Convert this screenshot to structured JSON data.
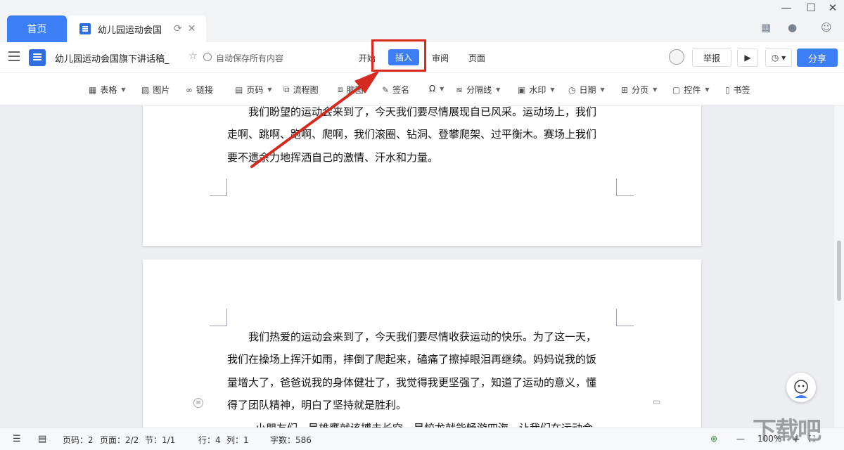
{
  "tabs": {
    "home": "首页",
    "doc": "幼儿园运动会国"
  },
  "header": {
    "doc_title": "幼儿园运动会国旗下讲话稿_",
    "autosave": "自动保存所有内容",
    "menu": [
      "开始",
      "插入",
      "审阅",
      "页面"
    ],
    "active_menu": "插入",
    "report": "举报",
    "share": "分享"
  },
  "tools": [
    {
      "icon": "table-icon",
      "label": "表格",
      "caret": true
    },
    {
      "icon": "image-icon",
      "label": "图片",
      "caret": false
    },
    {
      "icon": "link-icon",
      "label": "链接",
      "caret": false
    },
    {
      "icon": "page-number-icon",
      "label": "页码",
      "caret": true
    },
    {
      "icon": "flowchart-icon",
      "label": "流程图",
      "caret": false
    },
    {
      "icon": "mindmap-icon",
      "label": "脑图",
      "caret": false
    },
    {
      "icon": "signature-icon",
      "label": "签名",
      "caret": false
    },
    {
      "icon": "omega-icon",
      "label": "Ω",
      "caret": true
    },
    {
      "icon": "divider-icon",
      "label": "分隔线",
      "caret": true
    },
    {
      "icon": "watermark-icon",
      "label": "水印",
      "caret": true
    },
    {
      "icon": "date-icon",
      "label": "日期",
      "caret": true
    },
    {
      "icon": "page-break-icon",
      "label": "分页",
      "caret": true
    },
    {
      "icon": "widget-icon",
      "label": "控件",
      "caret": true
    },
    {
      "icon": "bookmark-icon",
      "label": "书签",
      "caret": false
    }
  ],
  "page1": {
    "lines": [
      "我们盼望的运动会来到了，今天我们要尽情展现自已风采。运动场上，我们",
      "走啊、跳啊、跑啊、爬啊，我们滚圈、钻洞、登攀爬架、过平衡木。赛场上我们",
      "要不遗余力地挥洒自己的激情、汗水和力量。"
    ]
  },
  "page2": {
    "lines": [
      "我们热爱的运动会来到了，今天我们要尽情收获运动的快乐。为了这一天，",
      "我们在操场上挥汗如雨，摔倒了爬起来，磕痛了擦掉眼泪再继续。妈妈说我的饭",
      "量增大了，爸爸说我的身体健壮了，我觉得我更坚强了，知道了运动的意义，懂",
      "得了团队精神，明白了坚持就是胜利。",
      "小朋友们，是雄鹰就该搏击长空，是蛟龙就能畅游四海。让我们在运动会"
    ]
  },
  "status": {
    "page_code": "页码：2",
    "pages": "页面：2/2",
    "section": "节：1/1",
    "row": "行：4",
    "col": "列：1",
    "words": "字数：586",
    "zoom": "100%",
    "minus": "—",
    "plus": "+"
  },
  "watermark": "下载吧",
  "colors": {
    "accent": "#3c7ef5",
    "highlight": "#e0251b"
  }
}
